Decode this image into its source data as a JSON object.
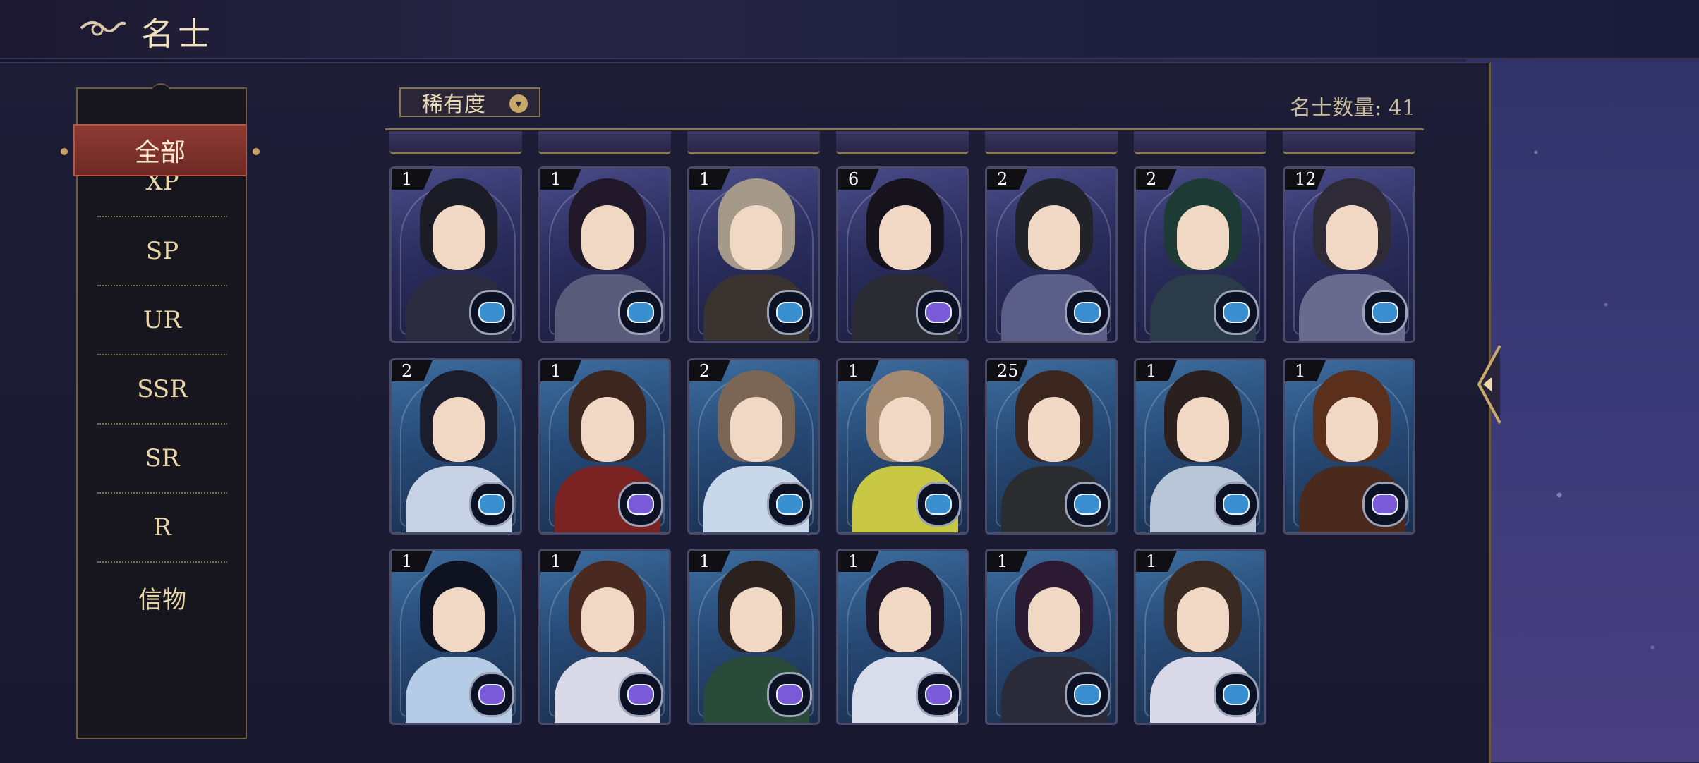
{
  "header": {
    "title": "名士"
  },
  "sidebar": {
    "active_item": "全部",
    "items": [
      "XP",
      "SP",
      "UR",
      "SSR",
      "SR",
      "R",
      "信物"
    ]
  },
  "filter": {
    "label": "稀有度",
    "count_text": "名士数量: 41"
  },
  "cards": [
    {
      "count": "1",
      "palette": "purple",
      "hair": "#1c1c26",
      "body": "#2c2c40",
      "badge": "blue"
    },
    {
      "count": "1",
      "palette": "purple",
      "hair": "#21182a",
      "body": "#5a5a7a",
      "badge": "blue"
    },
    {
      "count": "1",
      "palette": "purple",
      "hair": "#a59a8a",
      "body": "#3a3330",
      "badge": "blue"
    },
    {
      "count": "6",
      "palette": "purple",
      "hair": "#17131c",
      "body": "#2a2a33",
      "badge": "purple"
    },
    {
      "count": "2",
      "palette": "purple",
      "hair": "#21222a",
      "body": "#5a5e88",
      "badge": "blue"
    },
    {
      "count": "2",
      "palette": "purple",
      "hair": "#1d3a34",
      "body": "#2b3b4a",
      "badge": "blue"
    },
    {
      "count": "12",
      "palette": "purple",
      "hair": "#2e2a36",
      "body": "#6a6a8e",
      "badge": "blue"
    },
    {
      "count": "2",
      "palette": "blue",
      "hair": "#1b1c2c",
      "body": "#c7d2e6",
      "badge": "blue"
    },
    {
      "count": "1",
      "palette": "blue",
      "hair": "#3c2620",
      "body": "#7a2322",
      "badge": "purple"
    },
    {
      "count": "2",
      "palette": "blue",
      "hair": "#7b6656",
      "body": "#c9d7ea",
      "badge": "blue"
    },
    {
      "count": "1",
      "palette": "blue",
      "hair": "#a48a70",
      "body": "#c9c844",
      "badge": "blue"
    },
    {
      "count": "25",
      "palette": "blue",
      "hair": "#3b2620",
      "body": "#2b2c30",
      "badge": "blue"
    },
    {
      "count": "1",
      "palette": "blue",
      "hair": "#2a2020",
      "body": "#b8c6d8",
      "badge": "blue"
    },
    {
      "count": "1",
      "palette": "blue",
      "hair": "#5a2f1c",
      "body": "#4a2a1c",
      "badge": "purple"
    },
    {
      "count": "1",
      "palette": "blue",
      "hair": "#0f1220",
      "body": "#b6cce6",
      "badge": "purple"
    },
    {
      "count": "1",
      "palette": "blue",
      "hair": "#4a2a20",
      "body": "#d8d8e6",
      "badge": "purple"
    },
    {
      "count": "1",
      "palette": "blue",
      "hair": "#2b2220",
      "body": "#2a4a3a",
      "badge": "purple"
    },
    {
      "count": "1",
      "palette": "blue",
      "hair": "#21182a",
      "body": "#d8dceb",
      "badge": "purple"
    },
    {
      "count": "1",
      "palette": "blue",
      "hair": "#2b1a32",
      "body": "#2a2a38",
      "badge": "blue"
    },
    {
      "count": "1",
      "palette": "blue",
      "hair": "#3a2a24",
      "body": "#d8d8e8",
      "badge": "blue"
    }
  ],
  "colors": {
    "gold": "#e9d6a6",
    "active": "#8e3a33",
    "frame": "#6e5c3c"
  }
}
